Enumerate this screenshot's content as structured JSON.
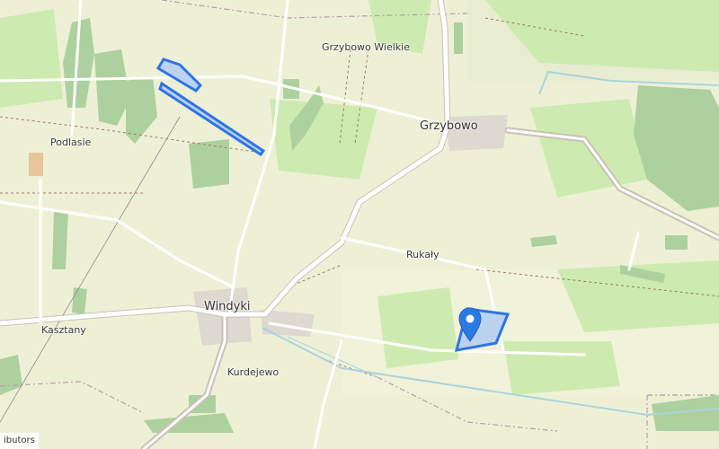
{
  "map": {
    "labels": {
      "grzybowo_wielkie": "Grzybowo Wielkie",
      "grzybowo": "Grzybowo",
      "podlasie": "Podlasie",
      "rukaly": "Rukały",
      "windyki": "Windyki",
      "kasztany": "Kasztany",
      "kurdejewo": "Kurdejewo"
    },
    "attribution": "ibutors",
    "marker_icon": "map-pin-icon",
    "colors": {
      "background": "#f2efe9",
      "farmland": "#eef0d6",
      "forest": "#add19e",
      "meadow": "#cdebb0",
      "road": "#ffffff",
      "road_casing": "#c8c2b6",
      "track": "#a07c5a",
      "water": "#aad3df",
      "boundary": "#b5a0a8",
      "parcel_stroke": "#2f74e6",
      "parcel_fill": "#bcd3f0",
      "marker": "#2a7ae2"
    }
  }
}
